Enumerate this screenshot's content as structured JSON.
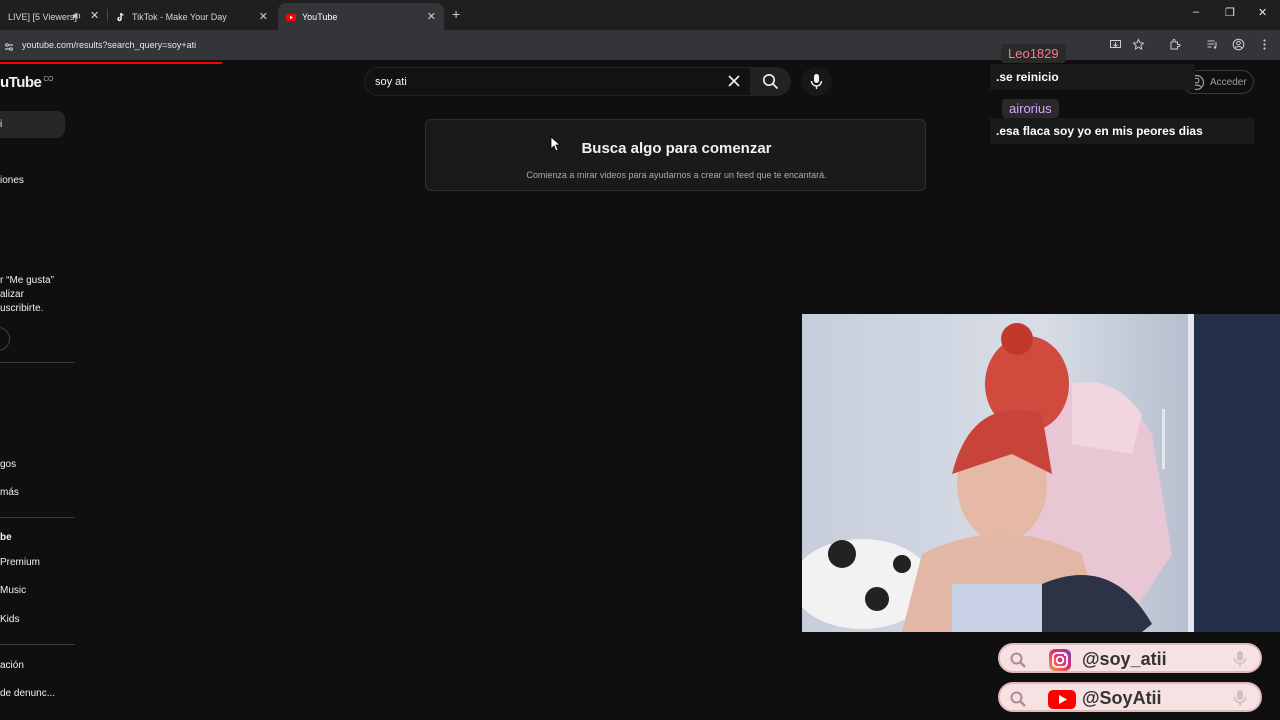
{
  "browser": {
    "tabs": [
      {
        "title": "LIVE] [5 Viewers]",
        "active": false
      },
      {
        "title": "TikTok - Make Your Day",
        "active": false
      },
      {
        "title": "YouTube",
        "active": true
      }
    ],
    "url": "youtube.com/results?search_query=soy+ati"
  },
  "youtube": {
    "logo": "uTube",
    "country_code": "CO",
    "search_query": "soy ati",
    "signin_label": "Acceder",
    "sidebar": {
      "subscriptions": "iones",
      "login_prompt": [
        "r “Me gusta”",
        "alizar",
        "uscribirte."
      ],
      "games": "gos",
      "more": "más",
      "section_title": "be",
      "premium": "Premium",
      "music": "Music",
      "kids": "Kids",
      "settings": "ación",
      "report": "de denunc..."
    },
    "empty_state": {
      "title": "Busca algo para comenzar",
      "subtitle": "Comienza a mirar videos para ayudarnos a crear un feed que te encantará."
    }
  },
  "chat": [
    {
      "user": "Leo1829",
      "message": ".se reinicio",
      "color": "#ff7a8a"
    },
    {
      "user": "airorius",
      "message": ".esa flaca soy yo en mis peores dias",
      "color": "#d9a3ff"
    }
  ],
  "socials": [
    {
      "platform": "instagram",
      "handle": "@soy_atii"
    },
    {
      "platform": "youtube",
      "handle": "@SoyAtii"
    }
  ],
  "colors": {
    "accent": "#ff0000",
    "background": "#0f0f0f"
  }
}
